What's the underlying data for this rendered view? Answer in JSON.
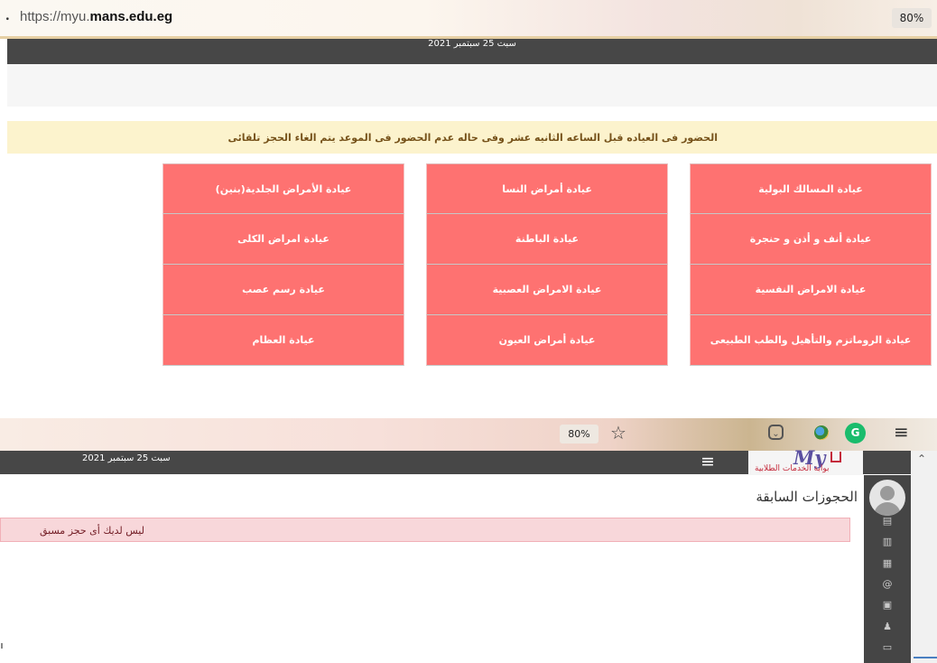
{
  "top": {
    "url_prefix": "https://myu.",
    "url_domain": "mans.edu.eg",
    "url_prefix_char": "?",
    "zoom": "80%",
    "date": "سبت 25 سبتمبر 2021",
    "notice": "الحضور فى العياده قبل الساعه الثانيه عشر وفى حاله عدم الحضور فى الموعد يتم الغاء الحجز تلقائى",
    "clinic_columns": [
      [
        "عيادة المسالك البولية",
        "عيادة أنف و أذن و حنجرة",
        "عيادة الامراض النفسية",
        "عيادة الروماتزم  والتأهيل والطب الطبيعى"
      ],
      [
        "عيادة أمراض النسا",
        "عيادة الباطنة",
        "عيادة الامراض العصبية",
        "عيادة أمراض العيون"
      ],
      [
        "عيادة الأمراض الجلدية(بنين)",
        "عيادة امراض الكلى",
        "عيادة رسم عصب",
        "عيادة العظام"
      ]
    ]
  },
  "bottom": {
    "zoom": "80%",
    "browser_icons": [
      "star-icon",
      "pocket-icon",
      "extension-icon",
      "grammarly-icon",
      "menu-icon"
    ],
    "date": "سبت 25 سبتمبر 2021",
    "logo_text": "My",
    "logo_subtitle": "بوابة الخدمات الطلابية",
    "section_title": "الحجوزات السابقة",
    "no_booking_message": "ليس لديك أى حجز مسبق",
    "sidebar_icons": [
      "card-icon",
      "chart-icon",
      "calendar-icon",
      "at-icon",
      "video-icon",
      "user-settings-icon",
      "id-card-icon"
    ]
  }
}
